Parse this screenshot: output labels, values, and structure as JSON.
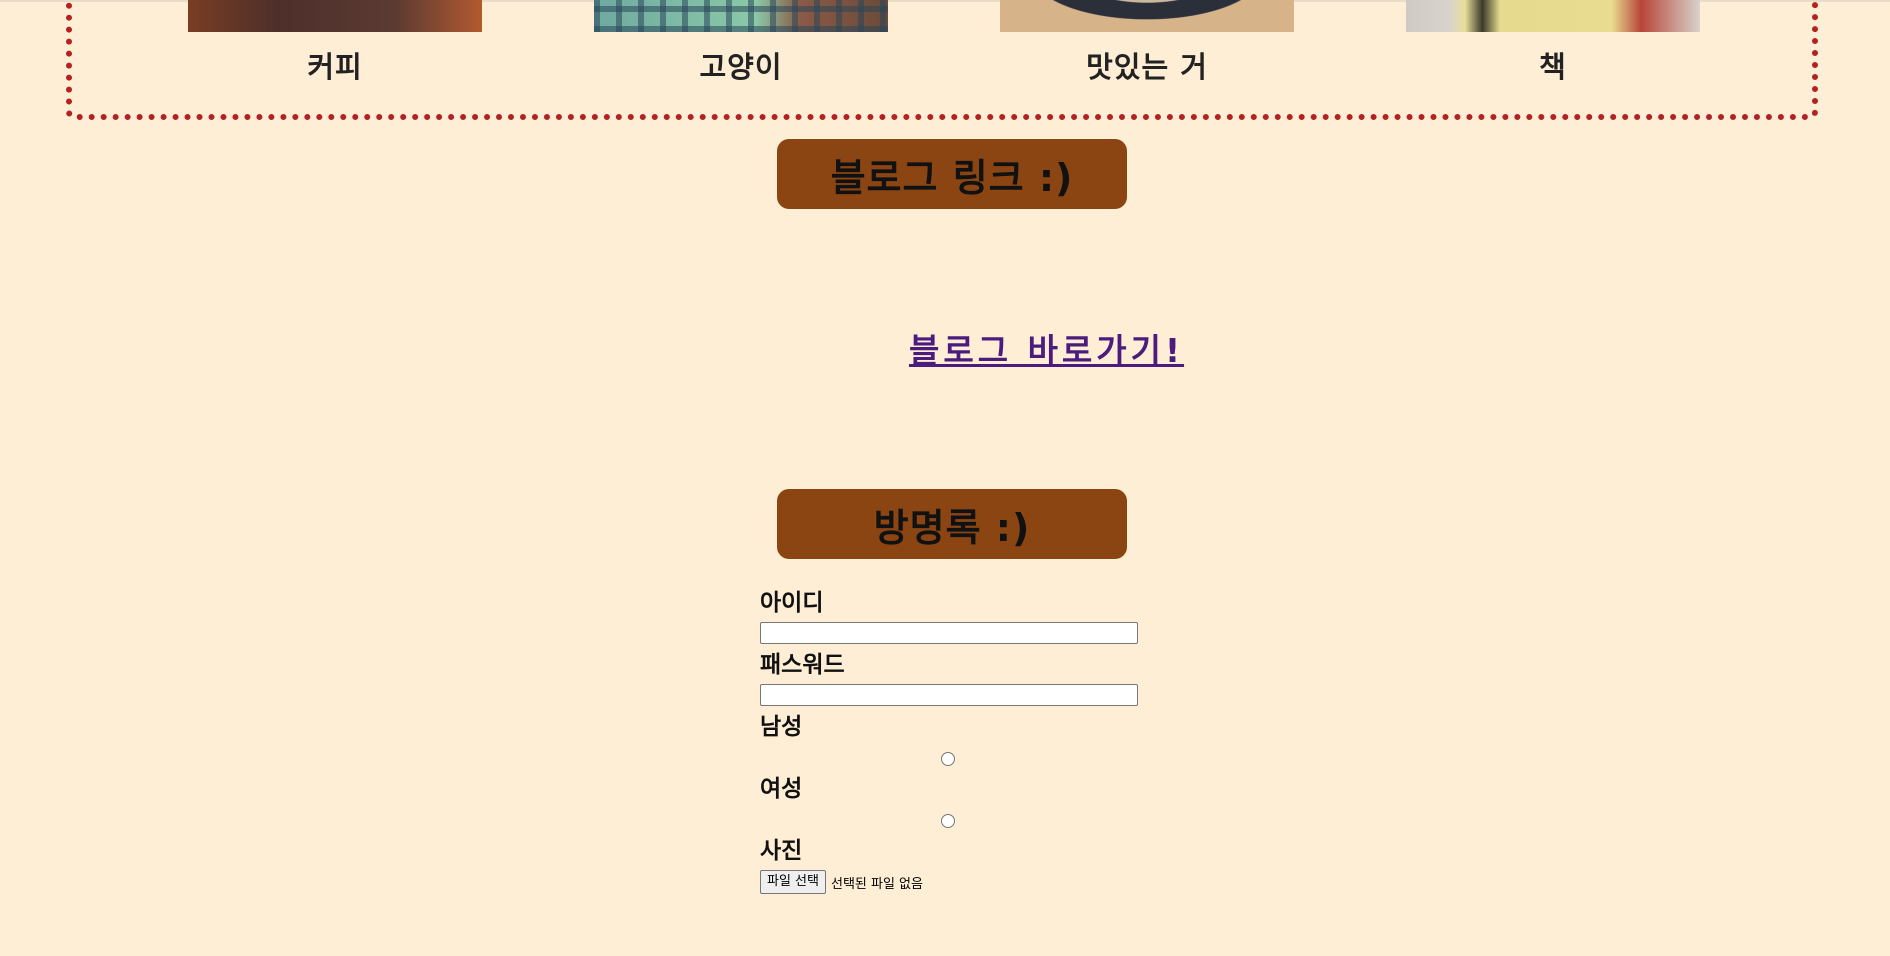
{
  "gallery": {
    "items": [
      {
        "caption": "커피",
        "image": "coffee-photo"
      },
      {
        "caption": "고양이",
        "image": "cat-photo"
      },
      {
        "caption": "맛있는 거",
        "image": "food-photo"
      },
      {
        "caption": "책",
        "image": "book-photo"
      }
    ]
  },
  "blog": {
    "header": "블로그 링크 :)",
    "link_text": "블로그 바로가기!"
  },
  "guestbook": {
    "header": "방명록 :)",
    "fields": {
      "id_label": "아이디",
      "id_value": "",
      "password_label": "패스워드",
      "password_value": "",
      "male_label": "남성",
      "female_label": "여성",
      "photo_label": "사진",
      "file_button": "파일 선택",
      "file_status": "선택된 파일 없음"
    }
  },
  "colors": {
    "background": "#ffeed6",
    "header_bg": "#8b4513",
    "dotted_border": "#b22222",
    "link": "#4b1b7e"
  }
}
